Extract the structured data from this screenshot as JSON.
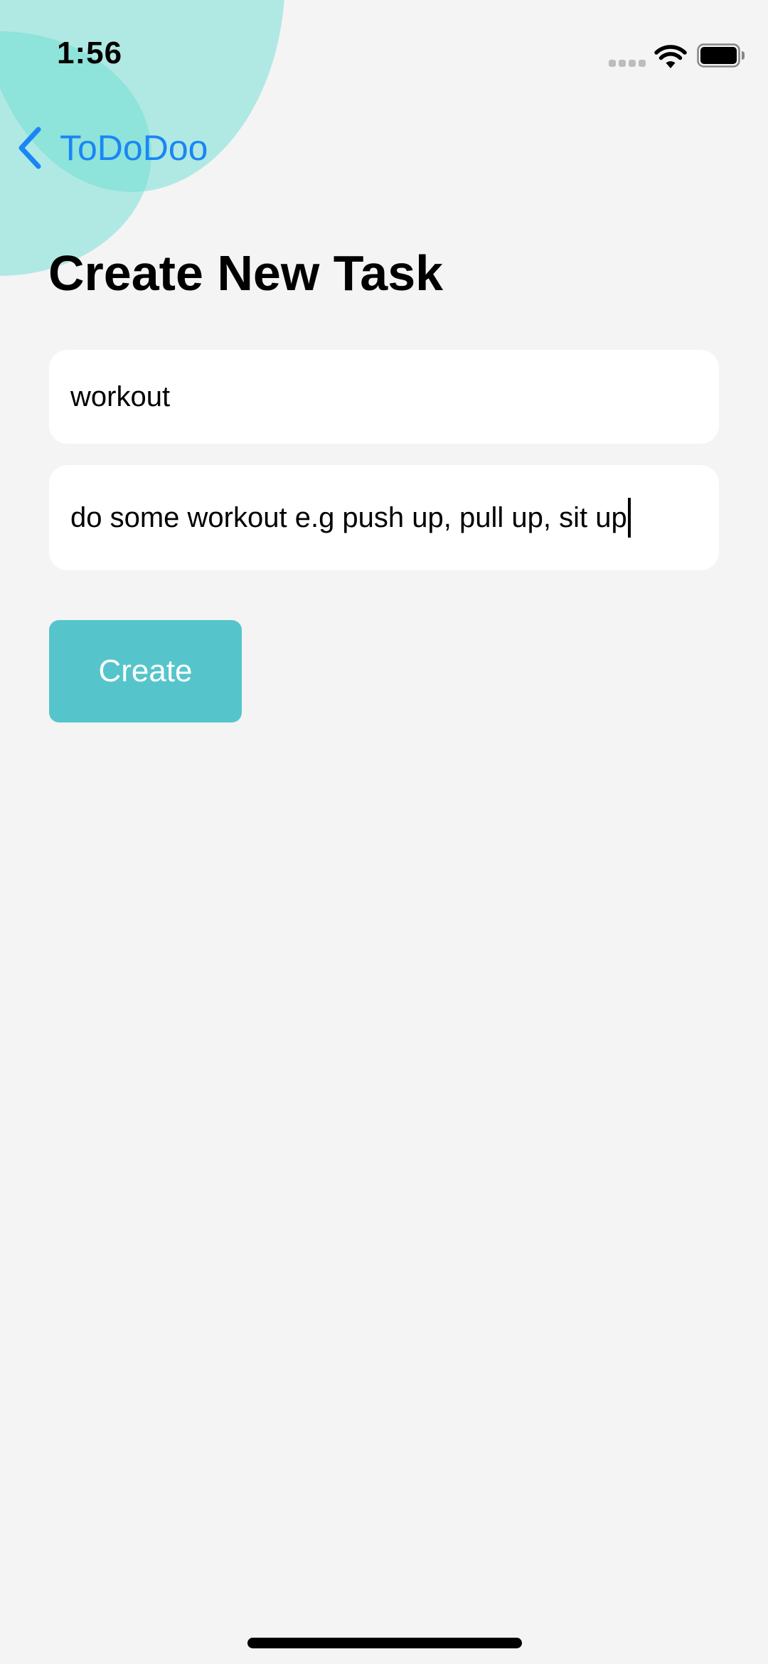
{
  "status_bar": {
    "time": "1:56"
  },
  "nav": {
    "back_label": "ToDoDoo"
  },
  "page": {
    "title": "Create New Task"
  },
  "form": {
    "task_title_value": "workout",
    "task_description_value": "do some workout e.g push up, pull up, sit up",
    "create_label": "Create"
  },
  "colors": {
    "accent_blue": "#1a86f5",
    "button_teal": "#55c5cb",
    "blob_teal": "#6bddd1",
    "background": "#f4f4f4"
  },
  "icons": {
    "back": "chevron-left-icon",
    "signal": "cellular-signal-icon",
    "wifi": "wifi-icon",
    "battery": "battery-icon"
  }
}
